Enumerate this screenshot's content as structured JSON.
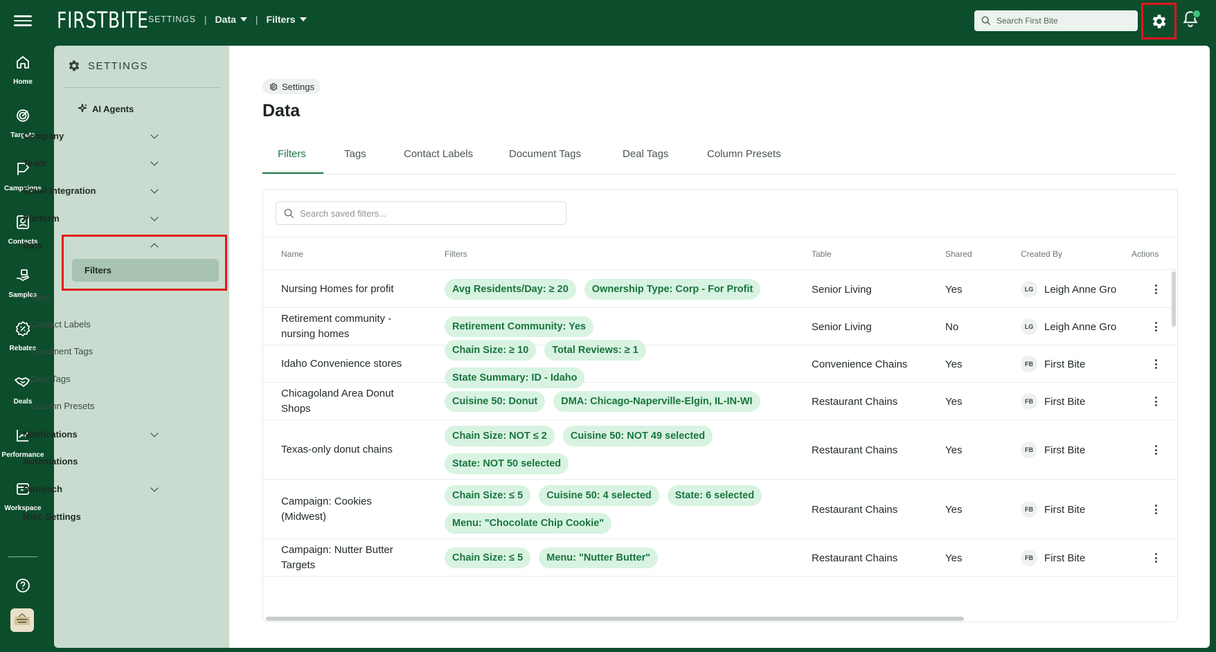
{
  "topbar": {
    "logo": "FIRSTBITE",
    "breadcrumb_settings": "SETTINGS",
    "separator": "|",
    "data_menu": "Data",
    "filters_menu": "Filters",
    "search_placeholder": "Search First Bite"
  },
  "rail": {
    "items": [
      {
        "label": "Home",
        "icon": "home-icon"
      },
      {
        "label": "Targets",
        "icon": "target-icon"
      },
      {
        "label": "Campaigns",
        "icon": "campaign-flag-icon"
      },
      {
        "label": "Contacts",
        "icon": "contacts-icon"
      },
      {
        "label": "Samples",
        "icon": "samples-icon"
      },
      {
        "label": "Rebates",
        "icon": "rebate-percent-icon"
      },
      {
        "label": "Deals",
        "icon": "handshake-icon"
      },
      {
        "label": "Performance",
        "icon": "line-chart-icon"
      },
      {
        "label": "Workspace",
        "icon": "workspace-icon"
      }
    ],
    "help_icon": "help-icon"
  },
  "settings_panel": {
    "title": "SETTINGS",
    "ai_agents": "AI Agents",
    "company": "Company",
    "team": "Team",
    "email_integration": "Email Integration",
    "platform": "Platform",
    "data": "Data",
    "data_sub": [
      "Filters",
      "Tags",
      "Contact Labels",
      "Document Tags",
      "Deal Tags",
      "Column Presets"
    ],
    "notifications": "Notifications",
    "automations": "Automations",
    "outreach": "Outreach",
    "misc": "Misc Settings"
  },
  "main": {
    "breadcrumb_pill": "Settings",
    "title": "Data",
    "tabs": [
      "Filters",
      "Tags",
      "Contact Labels",
      "Document Tags",
      "Deal Tags",
      "Column Presets"
    ],
    "active_tab": "Filters",
    "search_placeholder": "Search saved filters...",
    "columns": [
      "Name",
      "Filters",
      "Table",
      "Shared",
      "Created By",
      "Actions"
    ],
    "rows": [
      {
        "name": "Nursing Homes for profit",
        "filters": [
          "Avg Residents/Day: ≥ 20",
          "Ownership Type: Corp - For Profit"
        ],
        "table": "Senior Living",
        "shared": "Yes",
        "initials": "LG",
        "created_by": "Leigh Anne Gro"
      },
      {
        "name": "Retirement community - nursing homes",
        "filters": [
          "Retirement Community: Yes"
        ],
        "table": "Senior Living",
        "shared": "No",
        "initials": "LG",
        "created_by": "Leigh Anne Gro"
      },
      {
        "name": "Idaho Convenience stores",
        "filters": [
          "Chain Size: ≥ 10",
          "Total Reviews: ≥ 1",
          "State Summary: ID - Idaho"
        ],
        "table": "Convenience Chains",
        "shared": "Yes",
        "initials": "FB",
        "created_by": "First Bite"
      },
      {
        "name": "Chicagoland Area Donut Shops",
        "filters": [
          "Cuisine 50: Donut",
          "DMA: Chicago-Naperville-Elgin, IL-IN-WI"
        ],
        "table": "Restaurant Chains",
        "shared": "Yes",
        "initials": "FB",
        "created_by": "First Bite"
      },
      {
        "name": "Texas-only donut chains",
        "filters": [
          "Chain Size: NOT ≤ 2",
          "Cuisine 50: NOT 49 selected",
          "State: NOT 50 selected"
        ],
        "table": "Restaurant Chains",
        "shared": "Yes",
        "initials": "FB",
        "created_by": "First Bite"
      },
      {
        "name": "Campaign: Cookies (Midwest)",
        "filters": [
          "Chain Size: ≤ 5",
          "Cuisine 50: 4 selected",
          "State: 6 selected",
          "Menu: \"Chocolate Chip Cookie\""
        ],
        "table": "Restaurant Chains",
        "shared": "Yes",
        "initials": "FB",
        "created_by": "First Bite"
      },
      {
        "name": "Campaign: Nutter Butter Targets",
        "filters": [
          "Chain Size: ≤ 5",
          "Menu: \"Nutter Butter\""
        ],
        "table": "Restaurant Chains",
        "shared": "Yes",
        "initials": "FB",
        "created_by": "First Bite"
      }
    ]
  },
  "colors": {
    "brand_green": "#0c4d2c",
    "panel_green": "#c9dccf",
    "chip_bg": "#d8f3e1",
    "chip_text": "#19753f",
    "highlight_red": "#e3141b"
  }
}
